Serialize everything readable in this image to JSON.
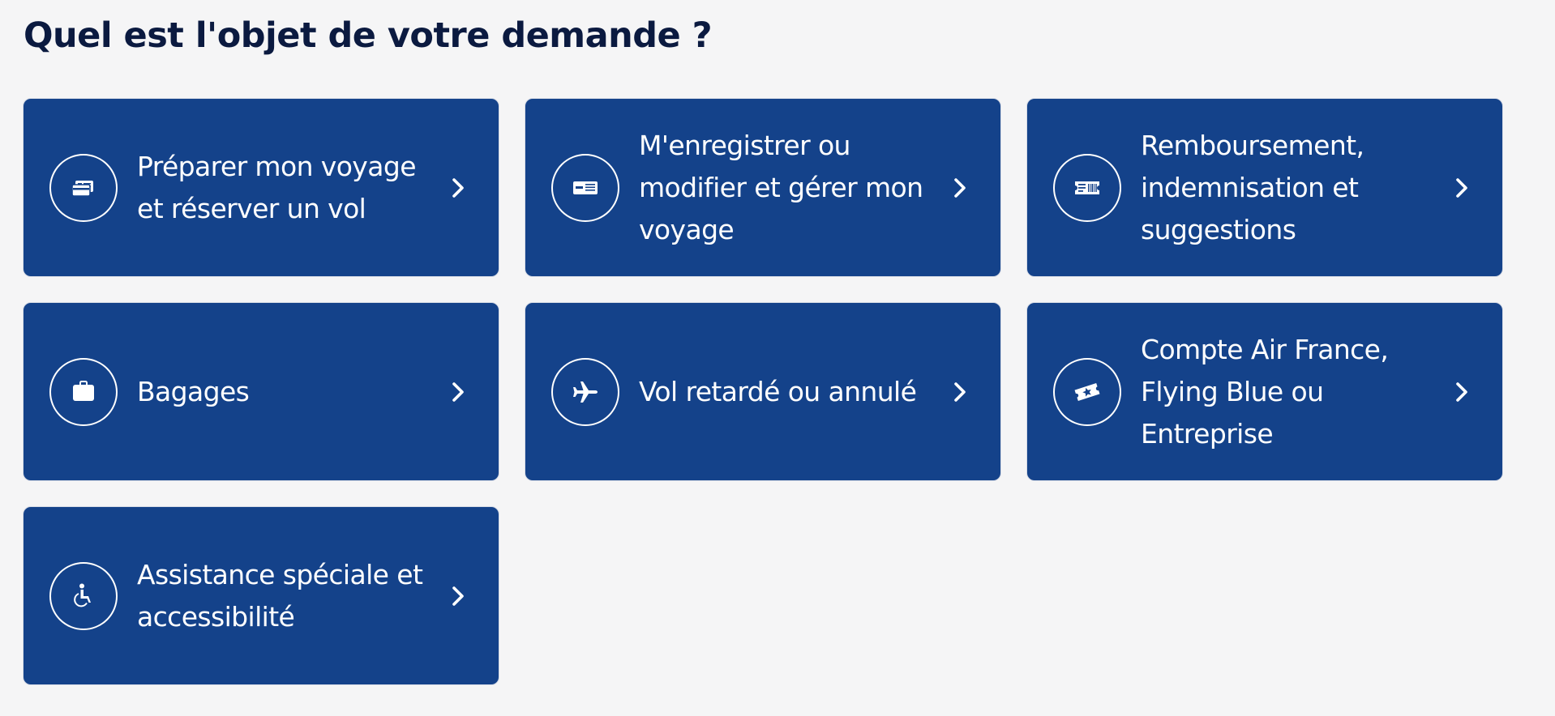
{
  "page": {
    "title": "Quel est l'objet de votre demande ?"
  },
  "colors": {
    "background": "#f5f5f6",
    "title": "#0b1a40",
    "card": "#14428a",
    "card_text": "#ffffff"
  },
  "cards": [
    {
      "label": "Préparer mon voyage et réserver un vol",
      "icon": "credit-card-icon"
    },
    {
      "label": "M'enregistrer ou modifier et gérer mon voyage",
      "icon": "boarding-pass-icon"
    },
    {
      "label": "Remboursement, indemnisation et suggestions",
      "icon": "ticket-icon"
    },
    {
      "label": "Bagages",
      "icon": "suitcase-icon"
    },
    {
      "label": "Vol retardé ou annulé",
      "icon": "airplane-icon"
    },
    {
      "label": "Compte Air France, Flying Blue ou Entreprise",
      "icon": "loyalty-card-icon"
    },
    {
      "label": "Assistance spéciale et accessibilité",
      "icon": "wheelchair-icon"
    }
  ]
}
